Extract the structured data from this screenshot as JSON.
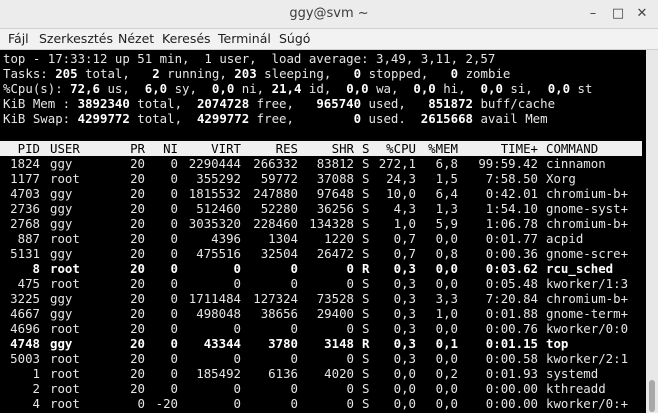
{
  "window": {
    "title": "ggy@svm ~",
    "buttons": [
      "–",
      "□",
      "✕"
    ]
  },
  "menu": [
    "Fájl",
    "Szerkesztés",
    "Nézet",
    "Keresés",
    "Terminál",
    "Súgó"
  ],
  "summary": {
    "line1": "top - 17:33:12 up 51 min,  1 user,  load average: 3,49, 3,11, 2,57",
    "tasks": [
      {
        "text": "Tasks: ",
        "bold": false
      },
      {
        "text": "205",
        "bold": true
      },
      {
        "text": " total,   ",
        "bold": false
      },
      {
        "text": "2",
        "bold": true
      },
      {
        "text": " running, ",
        "bold": false
      },
      {
        "text": "203",
        "bold": true
      },
      {
        "text": " sleeping,   ",
        "bold": false
      },
      {
        "text": "0",
        "bold": true
      },
      {
        "text": " stopped,   ",
        "bold": false
      },
      {
        "text": "0",
        "bold": true
      },
      {
        "text": " zombie",
        "bold": false
      }
    ],
    "cpu": [
      {
        "text": "%Cpu(s): ",
        "bold": false
      },
      {
        "text": "72,6",
        "bold": true
      },
      {
        "text": " us,  ",
        "bold": false
      },
      {
        "text": "6,0",
        "bold": true
      },
      {
        "text": " sy,  ",
        "bold": false
      },
      {
        "text": "0,0",
        "bold": true
      },
      {
        "text": " ni, ",
        "bold": false
      },
      {
        "text": "21,4",
        "bold": true
      },
      {
        "text": " id,  ",
        "bold": false
      },
      {
        "text": "0,0",
        "bold": true
      },
      {
        "text": " wa,  ",
        "bold": false
      },
      {
        "text": "0,0",
        "bold": true
      },
      {
        "text": " hi,  ",
        "bold": false
      },
      {
        "text": "0,0",
        "bold": true
      },
      {
        "text": " si,  ",
        "bold": false
      },
      {
        "text": "0,0",
        "bold": true
      },
      {
        "text": " st",
        "bold": false
      }
    ],
    "mem": [
      {
        "text": "KiB Mem : ",
        "bold": false
      },
      {
        "text": "3892340",
        "bold": true
      },
      {
        "text": " total,  ",
        "bold": false
      },
      {
        "text": "2074728",
        "bold": true
      },
      {
        "text": " free,   ",
        "bold": false
      },
      {
        "text": "965740",
        "bold": true
      },
      {
        "text": " used,   ",
        "bold": false
      },
      {
        "text": "851872",
        "bold": true
      },
      {
        "text": " buff/cache",
        "bold": false
      }
    ],
    "swap": [
      {
        "text": "KiB Swap: ",
        "bold": false
      },
      {
        "text": "4299772",
        "bold": true
      },
      {
        "text": " total,  ",
        "bold": false
      },
      {
        "text": "4299772",
        "bold": true
      },
      {
        "text": " free,        ",
        "bold": false
      },
      {
        "text": "0",
        "bold": true
      },
      {
        "text": " used.  ",
        "bold": false
      },
      {
        "text": "2615668",
        "bold": true
      },
      {
        "text": " avail Mem",
        "bold": false
      }
    ]
  },
  "columns": [
    "PID",
    "USER",
    "PR",
    "NI",
    "VIRT",
    "RES",
    "SHR",
    "S",
    "%CPU",
    "%MEM",
    "TIME+",
    "COMMAND"
  ],
  "processes": [
    {
      "pid": "1824",
      "user": "ggy",
      "pr": "20",
      "ni": "0",
      "virt": "2290444",
      "res": "266332",
      "shr": "83812",
      "s": "S",
      "cpu": "272,1",
      "mem": "6,8",
      "time": "99:59.42",
      "cmd": "cinnamon",
      "bold": false
    },
    {
      "pid": "1177",
      "user": "root",
      "pr": "20",
      "ni": "0",
      "virt": "355292",
      "res": "59772",
      "shr": "37088",
      "s": "S",
      "cpu": "24,3",
      "mem": "1,5",
      "time": "7:58.50",
      "cmd": "Xorg",
      "bold": false
    },
    {
      "pid": "4703",
      "user": "ggy",
      "pr": "20",
      "ni": "0",
      "virt": "1815532",
      "res": "247880",
      "shr": "97648",
      "s": "S",
      "cpu": "10,0",
      "mem": "6,4",
      "time": "0:42.01",
      "cmd": "chromium-b+",
      "bold": false
    },
    {
      "pid": "2736",
      "user": "ggy",
      "pr": "20",
      "ni": "0",
      "virt": "512460",
      "res": "52280",
      "shr": "36256",
      "s": "S",
      "cpu": "4,3",
      "mem": "1,3",
      "time": "1:54.10",
      "cmd": "gnome-syst+",
      "bold": false
    },
    {
      "pid": "2768",
      "user": "ggy",
      "pr": "20",
      "ni": "0",
      "virt": "3035320",
      "res": "228460",
      "shr": "134328",
      "s": "S",
      "cpu": "1,0",
      "mem": "5,9",
      "time": "1:06.78",
      "cmd": "chromium-b+",
      "bold": false
    },
    {
      "pid": "887",
      "user": "root",
      "pr": "20",
      "ni": "0",
      "virt": "4396",
      "res": "1304",
      "shr": "1220",
      "s": "S",
      "cpu": "0,7",
      "mem": "0,0",
      "time": "0:01.77",
      "cmd": "acpid",
      "bold": false
    },
    {
      "pid": "5131",
      "user": "ggy",
      "pr": "20",
      "ni": "0",
      "virt": "475516",
      "res": "32504",
      "shr": "26472",
      "s": "S",
      "cpu": "0,7",
      "mem": "0,8",
      "time": "0:00.36",
      "cmd": "gnome-scre+",
      "bold": false
    },
    {
      "pid": "8",
      "user": "root",
      "pr": "20",
      "ni": "0",
      "virt": "0",
      "res": "0",
      "shr": "0",
      "s": "R",
      "cpu": "0,3",
      "mem": "0,0",
      "time": "0:03.62",
      "cmd": "rcu_sched",
      "bold": true
    },
    {
      "pid": "475",
      "user": "root",
      "pr": "20",
      "ni": "0",
      "virt": "0",
      "res": "0",
      "shr": "0",
      "s": "S",
      "cpu": "0,3",
      "mem": "0,0",
      "time": "0:05.48",
      "cmd": "kworker/1:3",
      "bold": false
    },
    {
      "pid": "3225",
      "user": "ggy",
      "pr": "20",
      "ni": "0",
      "virt": "1711484",
      "res": "127324",
      "shr": "73528",
      "s": "S",
      "cpu": "0,3",
      "mem": "3,3",
      "time": "7:20.84",
      "cmd": "chromium-b+",
      "bold": false
    },
    {
      "pid": "4667",
      "user": "ggy",
      "pr": "20",
      "ni": "0",
      "virt": "498048",
      "res": "38656",
      "shr": "29400",
      "s": "S",
      "cpu": "0,3",
      "mem": "1,0",
      "time": "0:01.88",
      "cmd": "gnome-term+",
      "bold": false
    },
    {
      "pid": "4696",
      "user": "root",
      "pr": "20",
      "ni": "0",
      "virt": "0",
      "res": "0",
      "shr": "0",
      "s": "S",
      "cpu": "0,3",
      "mem": "0,0",
      "time": "0:00.76",
      "cmd": "kworker/0:0",
      "bold": false
    },
    {
      "pid": "4748",
      "user": "ggy",
      "pr": "20",
      "ni": "0",
      "virt": "43344",
      "res": "3780",
      "shr": "3148",
      "s": "R",
      "cpu": "0,3",
      "mem": "0,1",
      "time": "0:01.15",
      "cmd": "top",
      "bold": true
    },
    {
      "pid": "5003",
      "user": "root",
      "pr": "20",
      "ni": "0",
      "virt": "0",
      "res": "0",
      "shr": "0",
      "s": "S",
      "cpu": "0,3",
      "mem": "0,0",
      "time": "0:00.58",
      "cmd": "kworker/2:1",
      "bold": false
    },
    {
      "pid": "1",
      "user": "root",
      "pr": "20",
      "ni": "0",
      "virt": "185492",
      "res": "6136",
      "shr": "4020",
      "s": "S",
      "cpu": "0,0",
      "mem": "0,2",
      "time": "0:01.93",
      "cmd": "systemd",
      "bold": false
    },
    {
      "pid": "2",
      "user": "root",
      "pr": "20",
      "ni": "0",
      "virt": "0",
      "res": "0",
      "shr": "0",
      "s": "S",
      "cpu": "0,0",
      "mem": "0,0",
      "time": "0:00.00",
      "cmd": "kthreadd",
      "bold": false
    },
    {
      "pid": "4",
      "user": "root",
      "pr": "0",
      "ni": "-20",
      "virt": "0",
      "res": "0",
      "shr": "0",
      "s": "S",
      "cpu": "0,0",
      "mem": "0,0",
      "time": "0:00.00",
      "cmd": "kworker/0:+",
      "bold": false
    }
  ]
}
